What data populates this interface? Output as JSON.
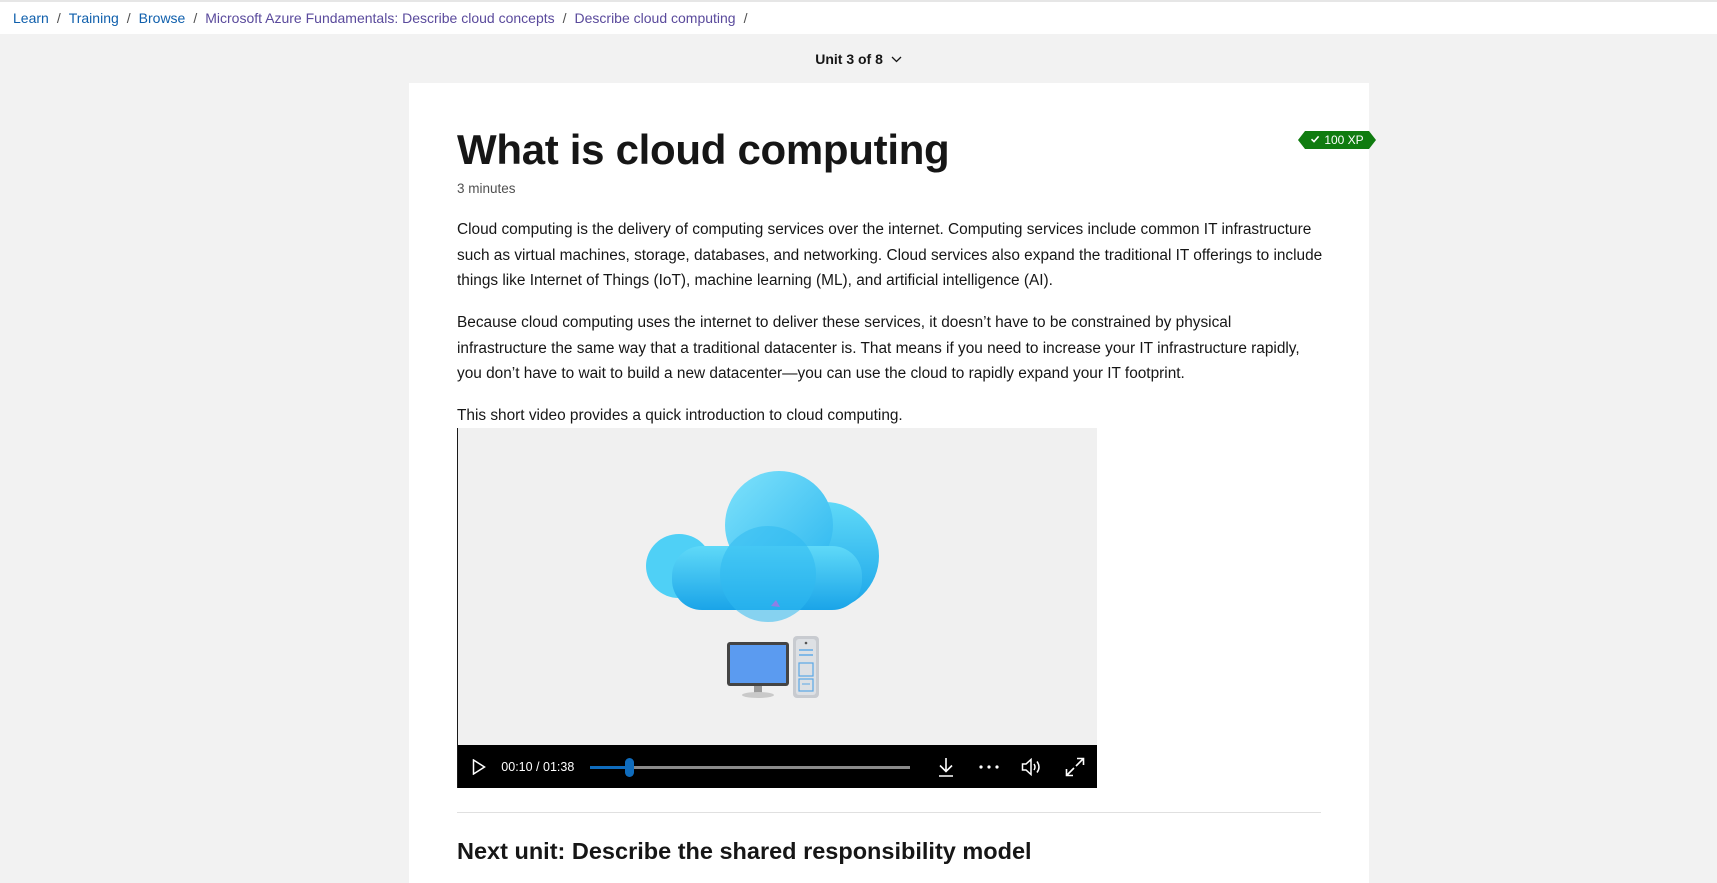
{
  "breadcrumb": [
    {
      "label": "Learn"
    },
    {
      "label": "Training"
    },
    {
      "label": "Browse"
    },
    {
      "label": "Microsoft Azure Fundamentals: Describe cloud concepts"
    },
    {
      "label": "Describe cloud computing"
    }
  ],
  "breadcrumb_separator": "/",
  "unit_selector": {
    "label": "Unit 3 of 8",
    "icon": "chevron-down-icon"
  },
  "unit": {
    "title": "What is cloud computing",
    "xp_badge": "100 XP",
    "xp_icon": "checkmark-icon",
    "duration": "3 minutes",
    "paragraphs": [
      "Cloud computing is the delivery of computing services over the internet. Computing services include common IT infrastructure such as virtual machines, storage, databases, and networking. Cloud services also expand the traditional IT offerings to include things like Internet of Things (IoT), machine learning (ML), and artificial intelligence (AI).",
      "Because cloud computing uses the internet to deliver these services, it doesn’t have to be constrained by physical infrastructure the same way that a traditional datacenter is. That means if you need to increase your IT infrastructure rapidly, you don’t have to wait to build a new datacenter—you can use the cloud to rapidly expand your IT footprint.",
      "This short video provides a quick introduction to cloud computing."
    ]
  },
  "video": {
    "time": "00:10 / 01:38",
    "progress_fraction": 0.12,
    "controls": [
      "play-icon",
      "download-icon",
      "more-icon",
      "volume-icon",
      "fullscreen-icon"
    ]
  },
  "next_unit": {
    "label": "Next unit: Describe the shared responsibility model"
  },
  "colors": {
    "link": "#0f5fac",
    "visited_link": "#5a4a9c",
    "xp_badge": "#107c10",
    "progress": "#0f6cbd",
    "page_background": "#f2f2f2"
  }
}
